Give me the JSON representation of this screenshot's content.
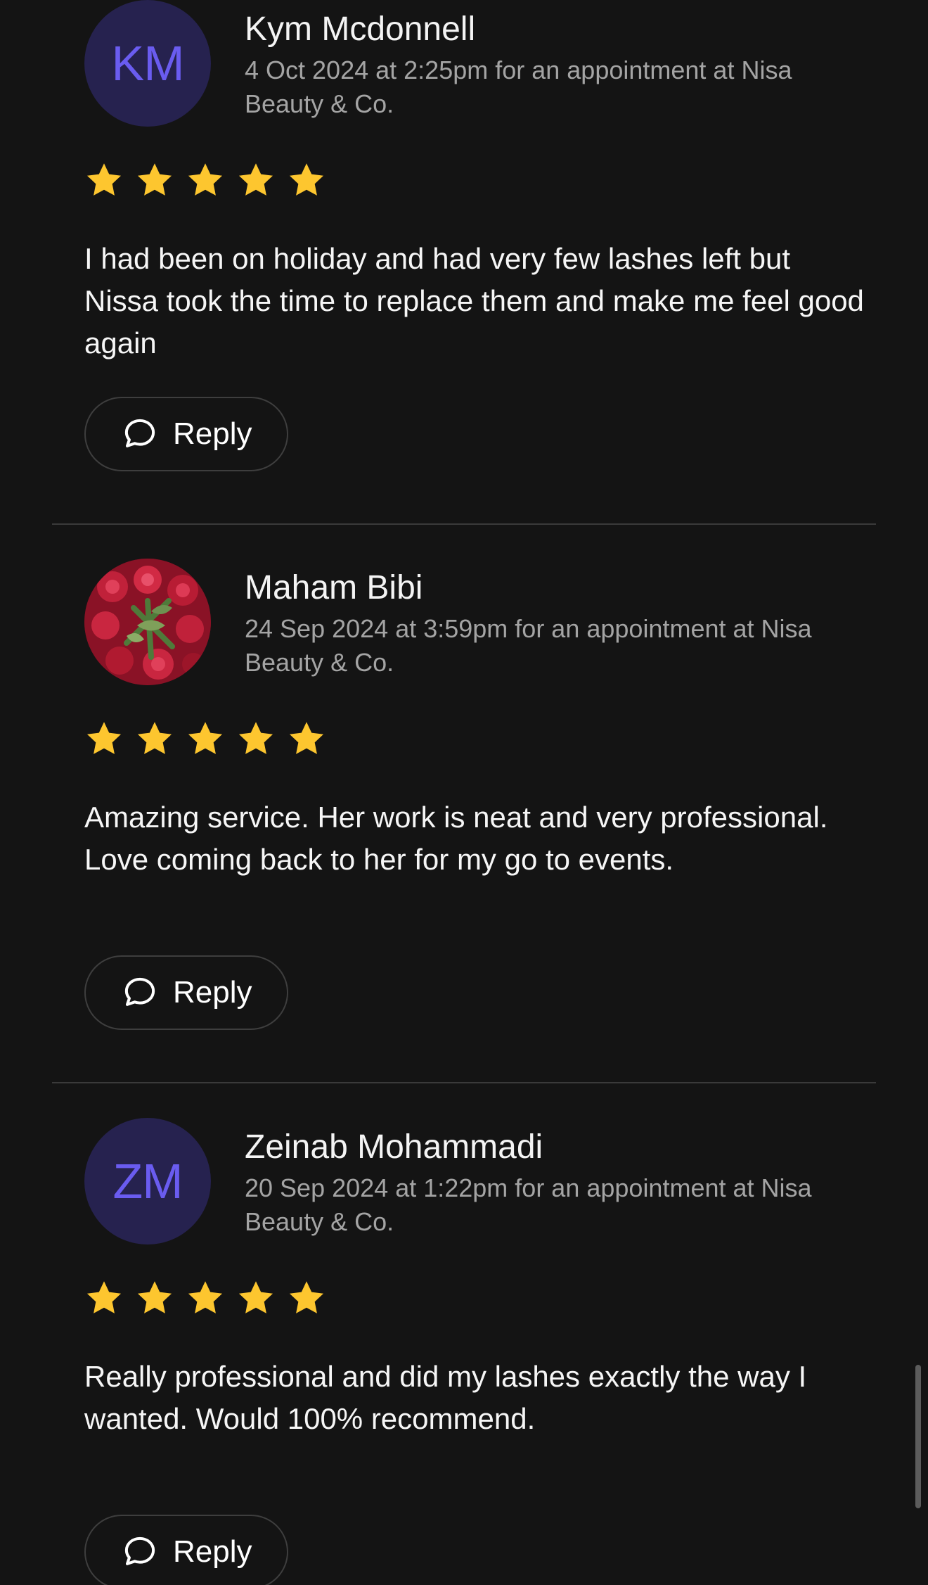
{
  "reviews": [
    {
      "avatar_initials": "KM",
      "name": "Kym Mcdonnell",
      "meta": "4 Oct 2024 at 2:25pm for an appointment at Nisa Beauty & Co.",
      "rating": 5,
      "text": "I had been on holiday and had very few lashes left but Nissa took the time to replace them and make me feel good again",
      "reply_label": "Reply"
    },
    {
      "avatar_initials": "",
      "avatar_image": "red-roses-bouquet",
      "name": "Maham Bibi",
      "meta": "24 Sep 2024 at 3:59pm for an appointment at Nisa Beauty & Co.",
      "rating": 5,
      "text": "Amazing service. Her work is neat and very professional. Love coming back to her for my go to events.",
      "reply_label": "Reply"
    },
    {
      "avatar_initials": "ZM",
      "name": "Zeinab Mohammadi",
      "meta": "20 Sep 2024 at 1:22pm for an appointment at Nisa Beauty & Co.",
      "rating": 5,
      "text": "Really professional and did my lashes exactly the way I wanted. Would 100% recommend.",
      "reply_label": "Reply"
    }
  ],
  "icons": {
    "star": "star-icon",
    "reply": "speech-bubble-icon"
  },
  "colors": {
    "background": "#141414",
    "star": "#fdc62f",
    "avatar_bg": "#26224f",
    "avatar_initials": "#6a5cf0",
    "meta_text": "#a4a4a4",
    "divider": "#3a3a3a"
  }
}
